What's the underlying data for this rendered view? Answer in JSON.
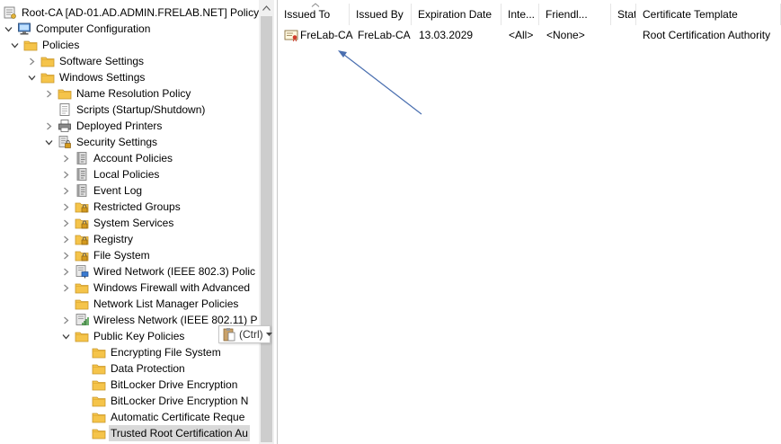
{
  "tree": {
    "items": [
      {
        "label": "Root-CA [AD-01.AD.ADMIN.FRELAB.NET] Policy",
        "icon": "policy-scroll-icon",
        "level": 0,
        "expander": "none"
      },
      {
        "label": "Computer Configuration",
        "icon": "computer-icon",
        "level": 0,
        "expander": "expanded"
      },
      {
        "label": "Policies",
        "icon": "folder-icon",
        "level": 1,
        "expander": "expanded"
      },
      {
        "label": "Software Settings",
        "icon": "folder-icon",
        "level": 2,
        "expander": "collapsed"
      },
      {
        "label": "Windows Settings",
        "icon": "folder-icon",
        "level": 2,
        "expander": "expanded"
      },
      {
        "label": "Name Resolution Policy",
        "icon": "folder-icon",
        "level": 3,
        "expander": "collapsed"
      },
      {
        "label": "Scripts (Startup/Shutdown)",
        "icon": "script-icon",
        "level": 3,
        "expander": "none"
      },
      {
        "label": "Deployed Printers",
        "icon": "printer-icon",
        "level": 3,
        "expander": "collapsed"
      },
      {
        "label": "Security Settings",
        "icon": "security-settings-icon",
        "level": 3,
        "expander": "expanded"
      },
      {
        "label": "Account Policies",
        "icon": "policy-book-icon",
        "level": 4,
        "expander": "collapsed"
      },
      {
        "label": "Local Policies",
        "icon": "policy-book-icon",
        "level": 4,
        "expander": "collapsed"
      },
      {
        "label": "Event Log",
        "icon": "policy-book-icon",
        "level": 4,
        "expander": "collapsed"
      },
      {
        "label": "Restricted Groups",
        "icon": "locked-folder-icon",
        "level": 4,
        "expander": "collapsed"
      },
      {
        "label": "System Services",
        "icon": "locked-folder-icon",
        "level": 4,
        "expander": "collapsed"
      },
      {
        "label": "Registry",
        "icon": "locked-folder-icon",
        "level": 4,
        "expander": "collapsed"
      },
      {
        "label": "File System",
        "icon": "locked-folder-icon",
        "level": 4,
        "expander": "collapsed"
      },
      {
        "label": "Wired Network (IEEE 802.3) Polic",
        "icon": "wired-network-icon",
        "level": 4,
        "expander": "collapsed"
      },
      {
        "label": "Windows Firewall with Advanced",
        "icon": "folder-icon",
        "level": 4,
        "expander": "collapsed"
      },
      {
        "label": "Network List Manager Policies",
        "icon": "folder-icon",
        "level": 4,
        "expander": "none"
      },
      {
        "label": "Wireless Network (IEEE 802.11) P",
        "icon": "wireless-network-icon",
        "level": 4,
        "expander": "collapsed"
      },
      {
        "label": "Public Key Policies",
        "icon": "folder-icon",
        "level": 4,
        "expander": "expanded"
      },
      {
        "label": "Encrypting File System",
        "icon": "folder-icon",
        "level": 5,
        "expander": "none"
      },
      {
        "label": "Data Protection",
        "icon": "folder-icon",
        "level": 5,
        "expander": "none"
      },
      {
        "label": "BitLocker Drive Encryption",
        "icon": "folder-icon",
        "level": 5,
        "expander": "none"
      },
      {
        "label": "BitLocker Drive Encryption N",
        "icon": "folder-icon",
        "level": 5,
        "expander": "none"
      },
      {
        "label": "Automatic Certificate Reque",
        "icon": "folder-icon",
        "level": 5,
        "expander": "none"
      },
      {
        "label": "Trusted Root Certification Au",
        "icon": "folder-icon",
        "level": 5,
        "expander": "none",
        "selected": true
      }
    ]
  },
  "paste_popup": {
    "label": "(Ctrl)",
    "icon": "clipboard-icon",
    "dropdown_icon": "caret-down-icon"
  },
  "list": {
    "columns": [
      "Issued To",
      "Issued By",
      "Expiration Date",
      "Inte...",
      "Friendl...",
      "Status",
      "Certificate Template"
    ],
    "rows": [
      {
        "icon": "certificate-icon",
        "cells": [
          "FreLab-CA",
          "FreLab-CA",
          "13.03.2029",
          "<All>",
          "<None>",
          "",
          "Root Certification Authority"
        ]
      }
    ]
  },
  "colors": {
    "selection": "#d9d9d9",
    "folder": "#f5c44a",
    "annotation_arrow": "#4a6fb0"
  }
}
